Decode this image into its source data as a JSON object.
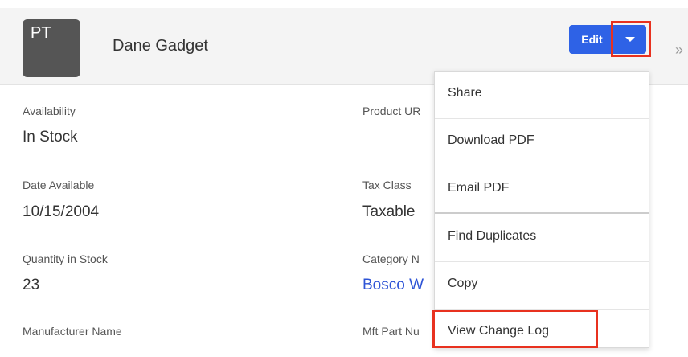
{
  "header": {
    "avatar_initials": "PT",
    "record_name": "Dane Gadget",
    "edit_label": "Edit",
    "expand_glyph": "»"
  },
  "fields": {
    "availability": {
      "label": "Availability",
      "value": "In Stock"
    },
    "product_url": {
      "label": "Product UR"
    },
    "date_available": {
      "label": "Date Available",
      "value": "10/15/2004"
    },
    "tax_class": {
      "label": "Tax Class",
      "value": "Taxable"
    },
    "quantity": {
      "label": "Quantity in Stock",
      "value": "23"
    },
    "category": {
      "label": "Category N",
      "value": "Bosco W"
    },
    "manufacturer": {
      "label": "Manufacturer Name"
    },
    "mft_part": {
      "label": "Mft Part Nu"
    }
  },
  "dropdown_menu": {
    "items": [
      {
        "label": "Share"
      },
      {
        "label": "Download PDF"
      },
      {
        "label": "Email PDF"
      },
      {
        "label": "Find Duplicates"
      },
      {
        "label": "Copy"
      },
      {
        "label": "View Change Log"
      }
    ]
  },
  "colors": {
    "accent": "#2e62e6",
    "highlight": "#e8311f",
    "link": "#2e54d6"
  }
}
